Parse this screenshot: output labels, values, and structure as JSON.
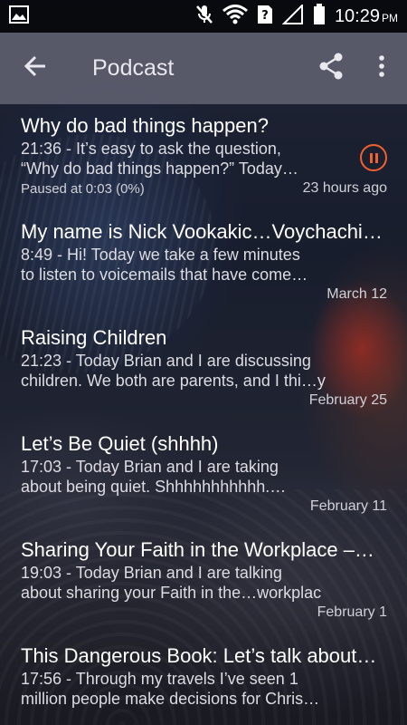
{
  "status_bar": {
    "time": "10:29",
    "ampm": "PM",
    "icons": [
      "image-icon",
      "mute-icon",
      "wifi-icon",
      "sim-unknown-icon",
      "signal-icon",
      "battery-icon"
    ]
  },
  "app_bar": {
    "title": "Podcast",
    "back_icon": "arrow-back-icon",
    "share_icon": "share-icon",
    "overflow_icon": "more-vert-icon"
  },
  "colors": {
    "accent": "#f0612f",
    "appbar": "#6e6e7d"
  },
  "episodes": [
    {
      "title": "Why do bad things happen?",
      "description": "21:36 - It’s easy to ask the question,\n“Why do bad things happen?”  Today…",
      "progress": "Paused at 0:03 (0%)",
      "date": "23 hours ago",
      "playing_control": "pause-icon"
    },
    {
      "title": "My name is Nick Vookakic…Voychachi…",
      "description": "8:49 - Hi! Today we take a few minutes\nto listen to voicemails that have come…",
      "date": "March 12"
    },
    {
      "title": "Raising Children",
      "description": "21:23 - Today Brian and I are discussing\nchildren. We both are parents, and I thi…y",
      "date": "February 25"
    },
    {
      "title": "Let’s Be Quiet (shhhh)",
      "description": "17:03 - Today Brian and I are taking\nabout being quiet. Shhhhhhhhhhh.…",
      "date": "February 11"
    },
    {
      "title": "Sharing Your Faith in the Workplace –…",
      "description": "19:03 - Today Brian and I are talking\nabout sharing your Faith in the…workplac",
      "date": "February 1"
    },
    {
      "title": "This Dangerous Book: Let’s talk about…",
      "description": "17:56 - Through my travels I’ve seen 1\nmillion people make decisions for Chris…",
      "date": ""
    }
  ]
}
